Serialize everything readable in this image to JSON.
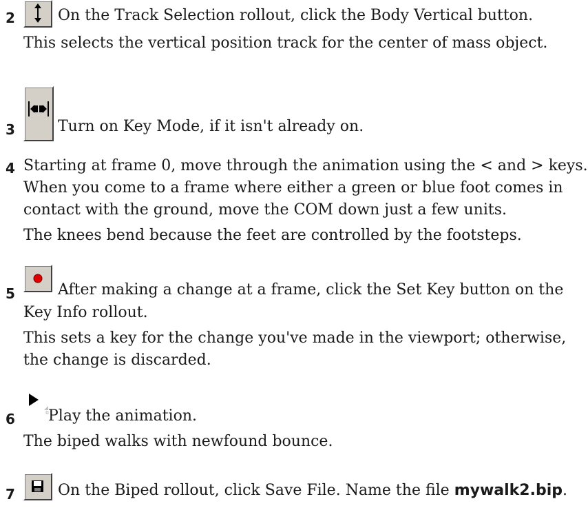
{
  "steps": [
    {
      "number": "2",
      "icon": "body-vertical-icon",
      "instruction": "On the Track Selection rollout, click the Body Vertical button.",
      "results": [
        "This selects the vertical position track for the center of mass object."
      ]
    },
    {
      "number": "3",
      "icon": "key-mode-icon",
      "instruction": "Turn on Key Mode, if it isn't already on.",
      "results": []
    },
    {
      "number": "4",
      "icon": "",
      "instruction_lines": [
        "Starting at frame 0, move through the animation using the < and > keys.",
        "When you come to a frame where either a green or blue foot comes in",
        "contact with the ground, move the COM down just a few units."
      ],
      "results": [
        "The knees bend because the feet are controlled by the footsteps."
      ]
    },
    {
      "number": "5",
      "icon": "set-key-icon",
      "instruction_lines": [
        "After making a change at a frame, click the Set Key button on the",
        "Key Info rollout."
      ],
      "result_lines": [
        "This sets a key for the change you've made in the viewport; otherwise,",
        "the change is discarded."
      ]
    },
    {
      "number": "6",
      "icon": "play-icon",
      "instruction": "Play the animation.",
      "results": [
        "The biped walks with newfound bounce."
      ]
    },
    {
      "number": "7",
      "icon": "save-file-icon",
      "instruction_prefix": "On the Biped rollout, click Save File. Name the file ",
      "file_name": "mywalk2.bip",
      "instruction_suffix": "."
    }
  ],
  "colors": {
    "button_face": "#d4d0c8",
    "key_red": "#e00000",
    "icon_dark": "#000000"
  }
}
